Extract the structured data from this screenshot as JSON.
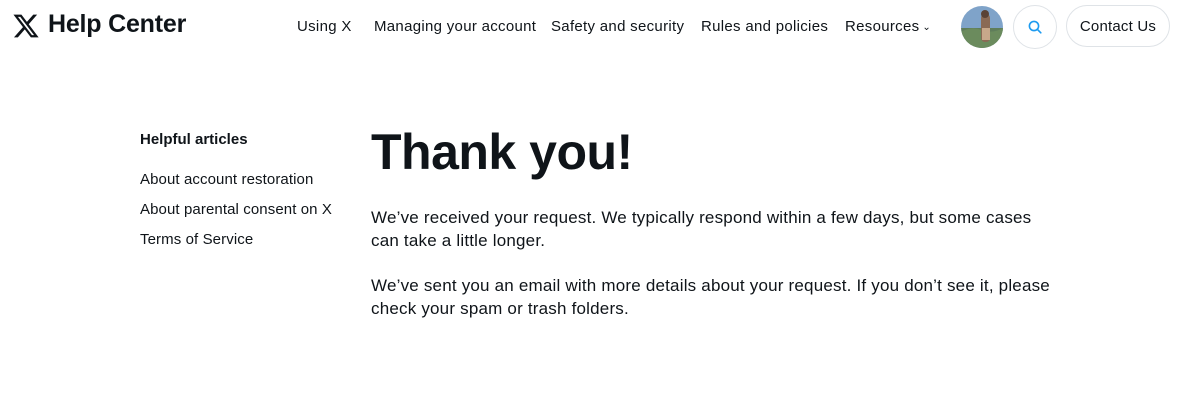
{
  "header": {
    "brand": "Help Center",
    "logo_icon": "x-logo-icon",
    "nav": [
      "Using X",
      "Managing your account",
      "Safety and security",
      "Rules and policies",
      "Resources"
    ],
    "contact_label": "Contact Us",
    "search_icon": "search-icon",
    "accent_color": "#1d9bf0"
  },
  "sidebar": {
    "title": "Helpful articles",
    "links": [
      "About account restoration",
      "About parental consent on X",
      "Terms of Service"
    ]
  },
  "main": {
    "title": "Thank you!",
    "paragraphs": [
      "We’ve received your request. We typically respond within a few days, but some cases can take a little longer.",
      "We’ve sent you an email with more details about your request. If you don’t see it, please check your spam or trash folders."
    ]
  }
}
